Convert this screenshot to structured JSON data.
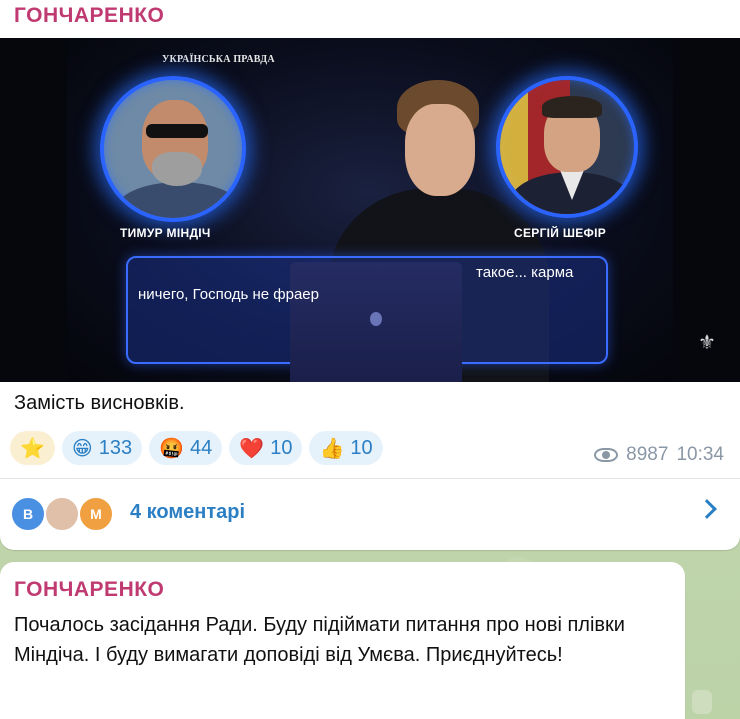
{
  "post1": {
    "sender": "ГОНЧАРЕНКО",
    "media": {
      "watermark": "УКРАЇНСЬКА ПРАВДА",
      "name_left": "ТИМУР МІНДІЧ",
      "name_right": "СЕРГІЙ ШЕФІР",
      "caption_line_1": "ничего, Господь не фраер",
      "caption_line_2": "такое... карма"
    },
    "text": "Замість висновків.",
    "reactions": [
      {
        "emoji": "⭐",
        "count": ""
      },
      {
        "emoji": "😁",
        "count": "133"
      },
      {
        "emoji": "🤬",
        "count": "44"
      },
      {
        "emoji": "❤️",
        "count": "10"
      },
      {
        "emoji": "👍",
        "count": "10"
      }
    ],
    "views": "8987",
    "time": "10:34",
    "comments": {
      "avatars": [
        "B",
        "",
        "M"
      ],
      "label": "4 коментарі"
    }
  },
  "post2": {
    "sender": "ГОНЧАРЕНКО",
    "text": "Почалось засідання Ради. Буду підіймати питання про нові плівки Міндіча. І буду вимагати доповіді від Умєва. Приєднуйтесь!"
  },
  "colors": {
    "sender": "#c03a72",
    "link": "#2b7fc4",
    "accent_ring": "#2b63ff"
  }
}
